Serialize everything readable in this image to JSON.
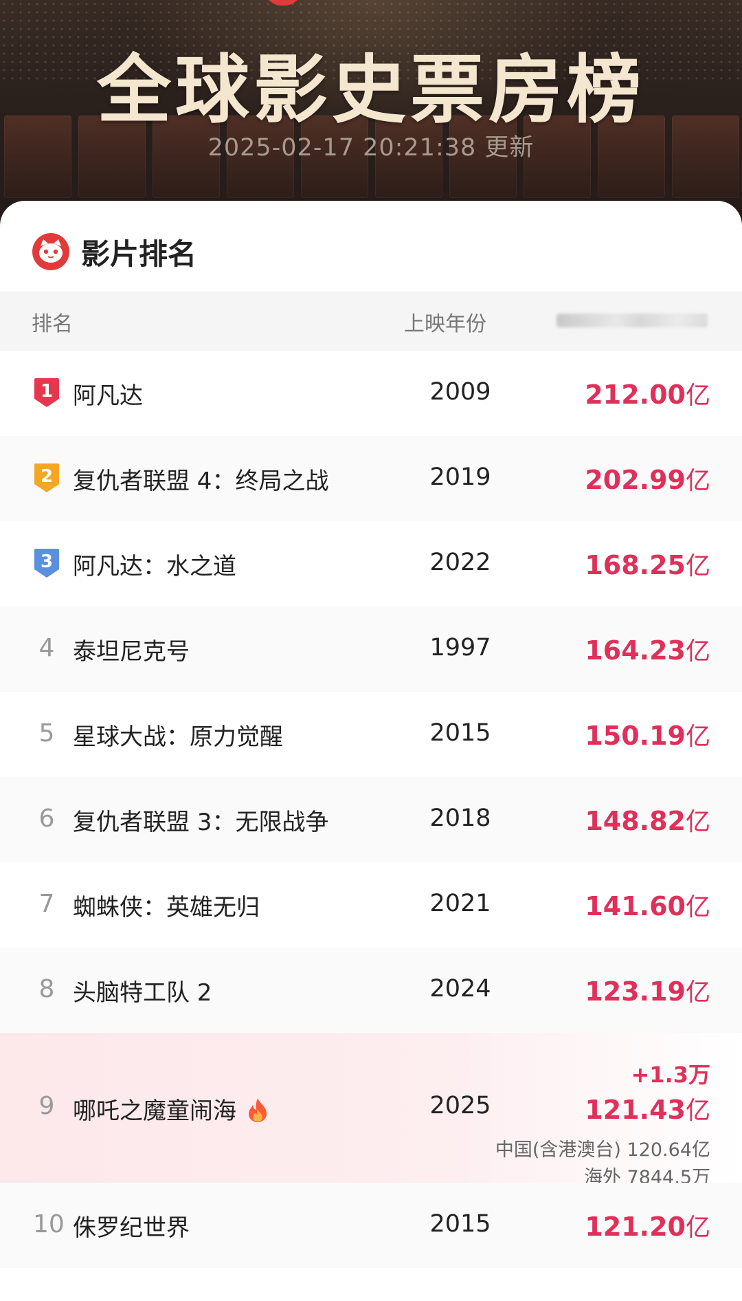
{
  "header": {
    "title": "全球影史票房榜",
    "updated": "2025-02-17 20:21:38 更新"
  },
  "card": {
    "title": "影片排名"
  },
  "columns": {
    "rank": "排名",
    "year": "上映年份"
  },
  "colors": {
    "accent": "#e0305a",
    "gold": "#f4e6cf",
    "medal_1": "#e5384e",
    "medal_2": "#f5a623",
    "medal_3": "#5b8fe0"
  },
  "rows": [
    {
      "rank": "1",
      "title": "阿凡达",
      "year": "2009",
      "gross": "212.00",
      "unit": "亿"
    },
    {
      "rank": "2",
      "title": "复仇者联盟 4：终局之战",
      "year": "2019",
      "gross": "202.99",
      "unit": "亿"
    },
    {
      "rank": "3",
      "title": "阿凡达：水之道",
      "year": "2022",
      "gross": "168.25",
      "unit": "亿"
    },
    {
      "rank": "4",
      "title": "泰坦尼克号",
      "year": "1997",
      "gross": "164.23",
      "unit": "亿"
    },
    {
      "rank": "5",
      "title": "星球大战：原力觉醒",
      "year": "2015",
      "gross": "150.19",
      "unit": "亿"
    },
    {
      "rank": "6",
      "title": "复仇者联盟 3：无限战争",
      "year": "2018",
      "gross": "148.82",
      "unit": "亿"
    },
    {
      "rank": "7",
      "title": "蜘蛛侠：英雄无归",
      "year": "2021",
      "gross": "141.60",
      "unit": "亿"
    },
    {
      "rank": "8",
      "title": "头脑特工队 2",
      "year": "2024",
      "gross": "123.19",
      "unit": "亿"
    },
    {
      "rank": "9",
      "title": "哪吒之魔童闹海",
      "year": "2025",
      "gross": "121.43",
      "unit": "亿",
      "delta": "+1.3万",
      "china": "中国(含港澳台) 120.64亿",
      "overseas": "海外 7844.5万"
    },
    {
      "rank": "10",
      "title": "侏罗纪世界",
      "year": "2015",
      "gross": "121.20",
      "unit": "亿"
    }
  ]
}
